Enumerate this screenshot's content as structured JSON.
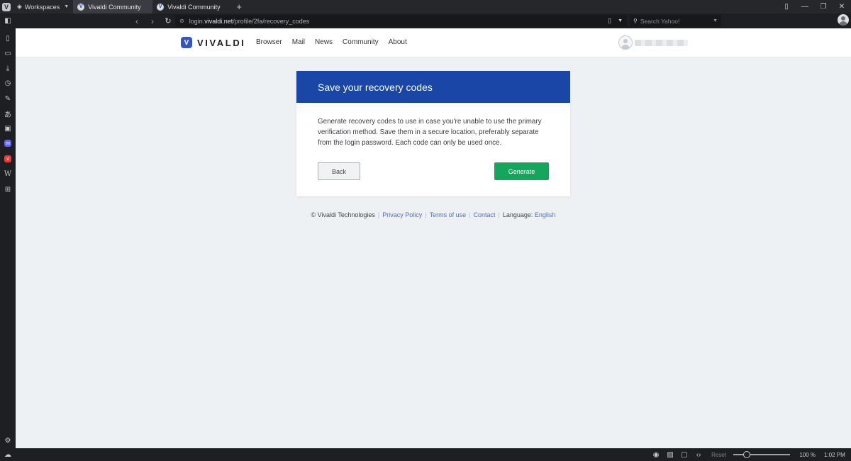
{
  "browser": {
    "tabs": [
      {
        "label": "Vivaldi Community",
        "active": true
      },
      {
        "label": "Vivaldi Community",
        "active": false
      }
    ],
    "workspaces_label": "Workspaces",
    "address": {
      "host_prefix": "login.",
      "host_main": "vivaldi.net",
      "path": "/profile/2fa/recovery_codes"
    },
    "search": {
      "placeholder": "Search Yahoo!"
    },
    "status": {
      "reset_label": "Reset",
      "zoom": "100 %",
      "clock": "1:02 PM"
    }
  },
  "site": {
    "logo_text": "VIVALDI",
    "nav": [
      "Browser",
      "Mail",
      "News",
      "Community",
      "About"
    ]
  },
  "card": {
    "title": "Save your recovery codes",
    "body": "Generate recovery codes to use in case you're unable to use the primary verification method. Save them in a secure location, preferably separate from the login password. Each code can only be used once.",
    "back_label": "Back",
    "generate_label": "Generate"
  },
  "footer": {
    "copyright": "© Vivaldi Technologies",
    "privacy": "Privacy Policy",
    "terms": "Terms of use",
    "contact": "Contact",
    "language_label": "Language:",
    "language_value": "English"
  },
  "colors": {
    "card_header": "#1a46a8",
    "generate_button": "#14a65c",
    "link": "#4f6fb8"
  }
}
